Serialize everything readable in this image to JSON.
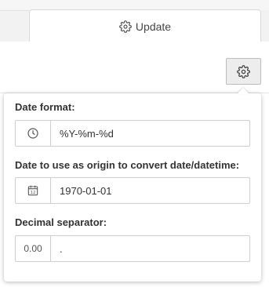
{
  "tabs": {
    "update_label": "Update"
  },
  "settings_popover": {
    "date_format": {
      "label": "Date format:",
      "value": "%Y-%m-%d",
      "icon": "clock-icon"
    },
    "date_origin": {
      "label": "Date to use as origin to convert date/datetime:",
      "value": "1970-01-01",
      "icon": "calendar-icon",
      "icon_text": "12"
    },
    "decimal_separator": {
      "label": "Decimal separator:",
      "addon_text": "0.00",
      "value": "."
    }
  },
  "colors": {
    "border": "#cfcfcf",
    "background": "#f6f6f6",
    "button_bg": "#ededed"
  }
}
